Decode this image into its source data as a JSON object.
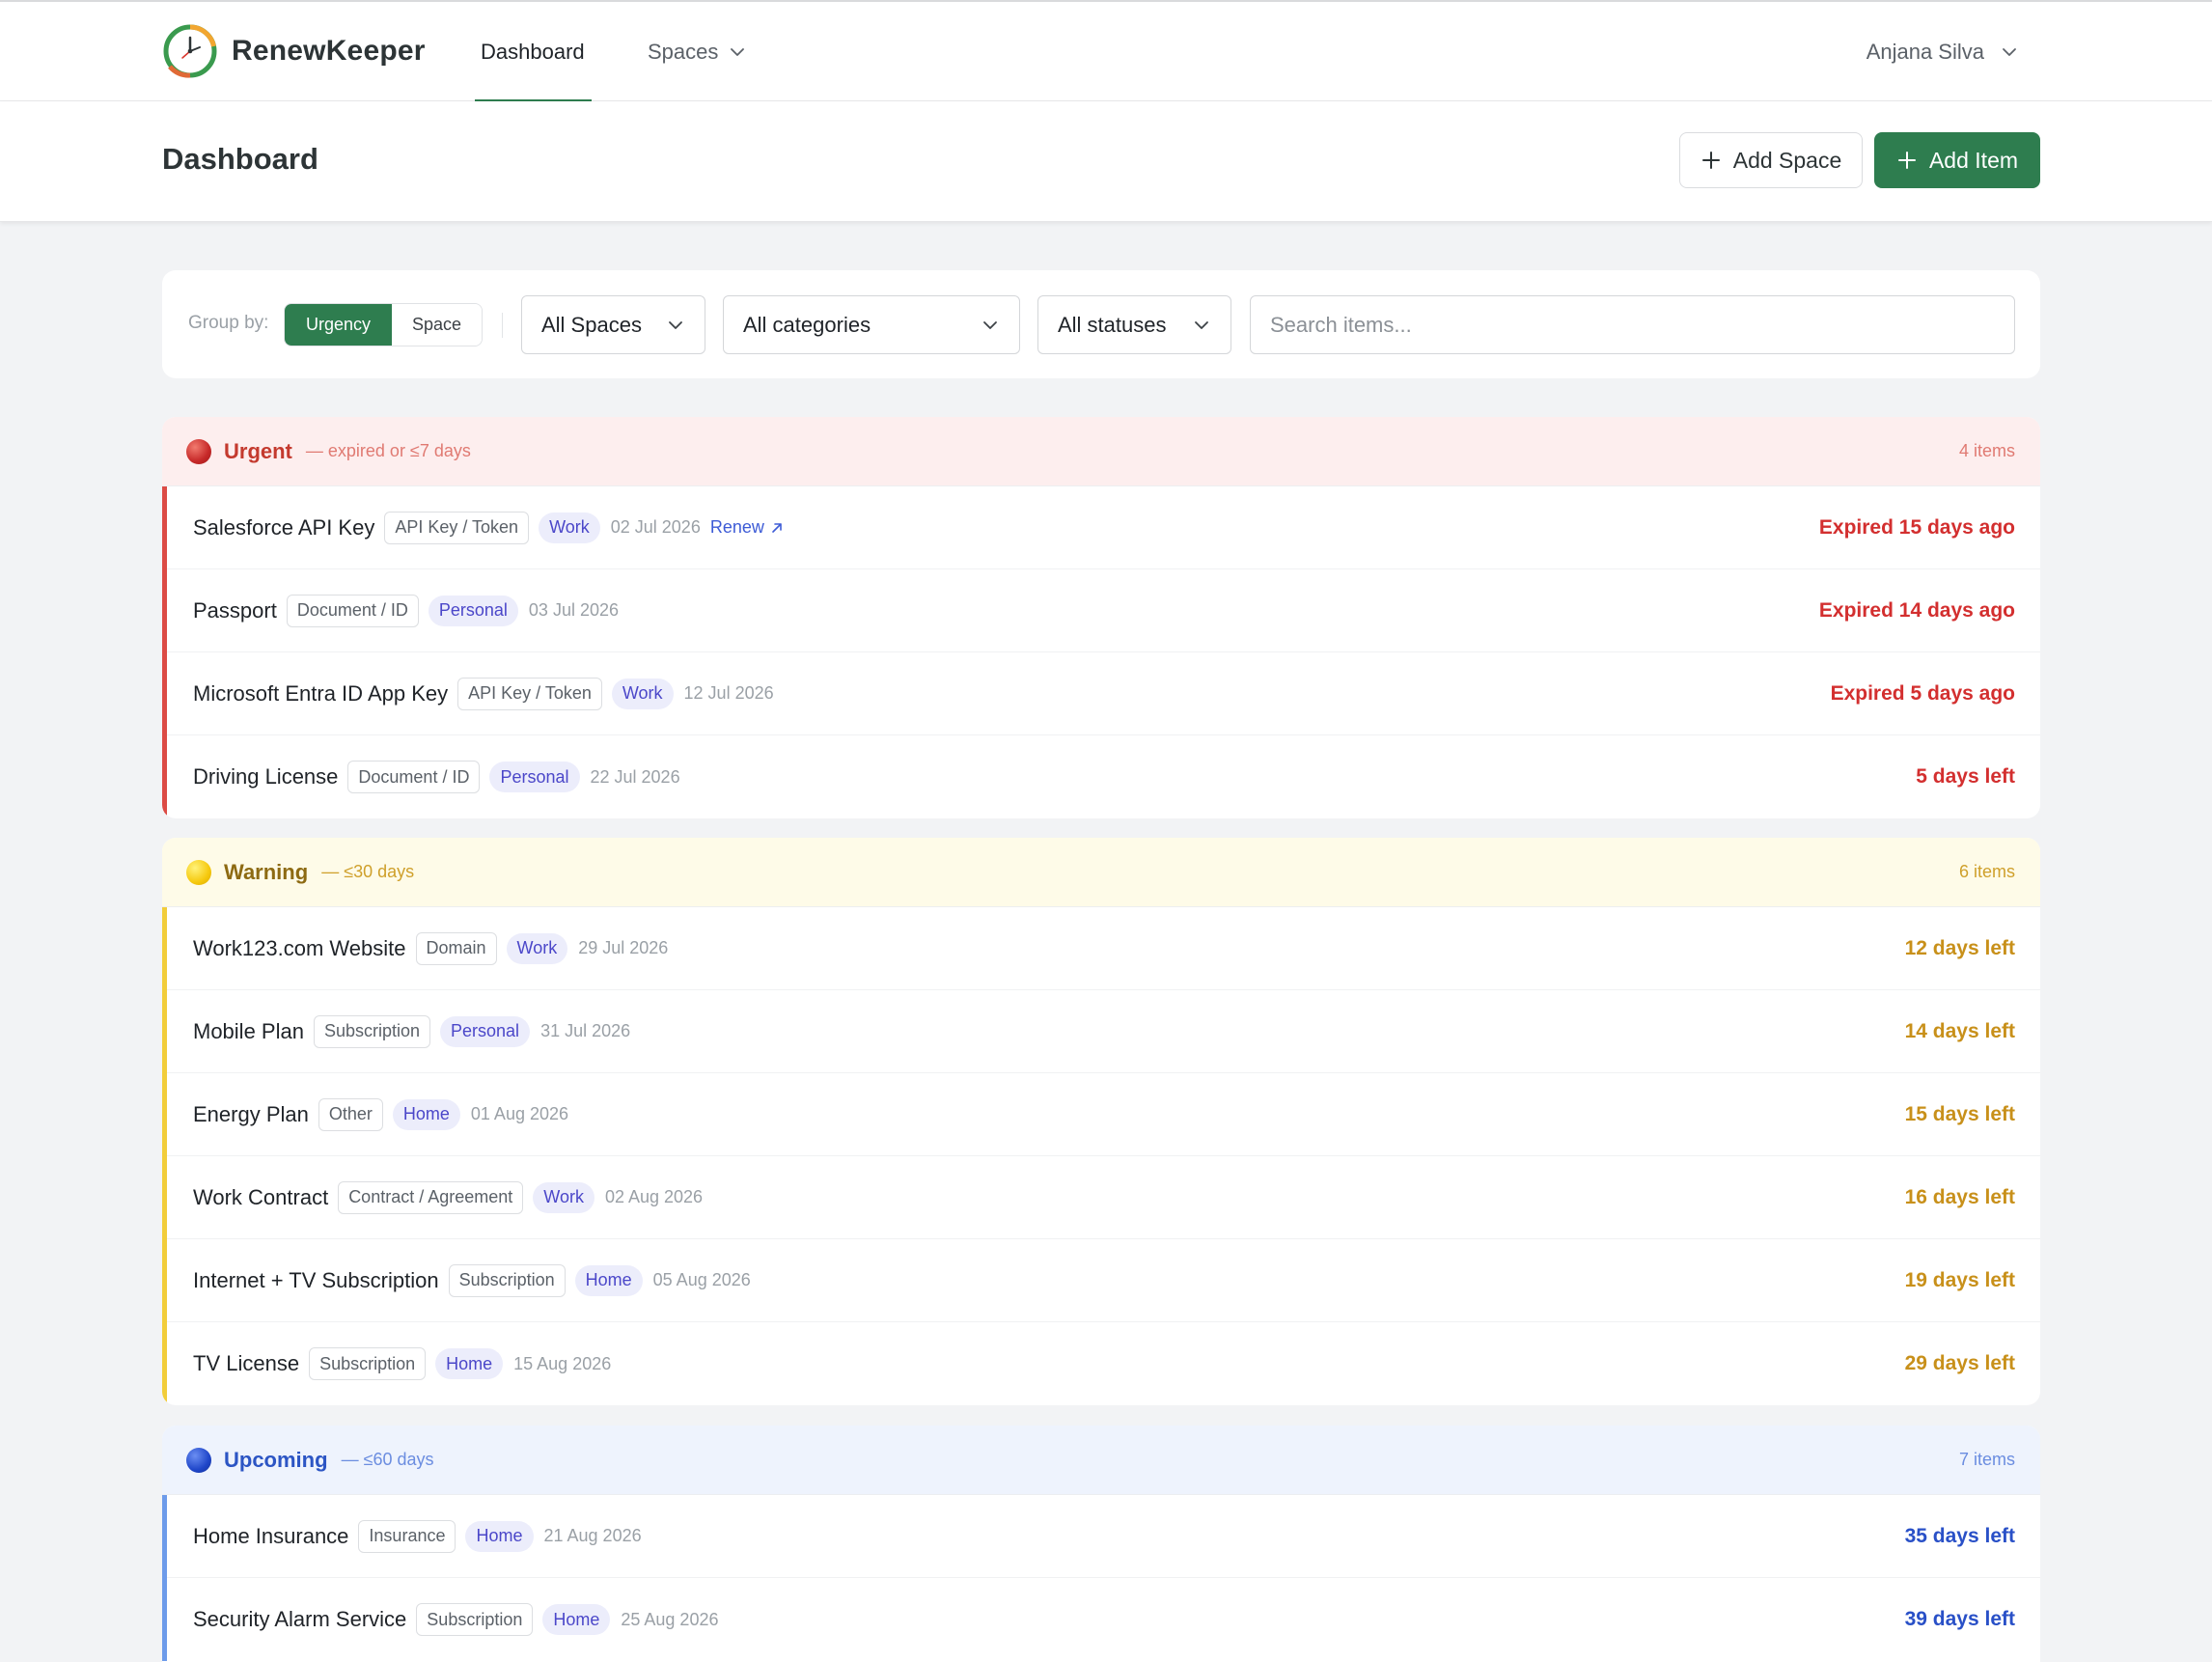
{
  "app": {
    "name": "RenewKeeper"
  },
  "nav": {
    "dashboard": "Dashboard",
    "spaces": "Spaces",
    "user": "Anjana Silva"
  },
  "page": {
    "title": "Dashboard",
    "add_space": "Add Space",
    "add_item": "Add Item"
  },
  "filters": {
    "group_by_label": "Group by:",
    "group_urgency": "Urgency",
    "group_space": "Space",
    "spaces": "All Spaces",
    "categories": "All categories",
    "statuses": "All statuses",
    "search_placeholder": "Search items..."
  },
  "groups": [
    {
      "title": "Urgent",
      "subtitle": "— expired or ≤7 days",
      "count": "4 items",
      "items": [
        {
          "name": "Salesforce API Key",
          "category": "API Key / Token",
          "space": "Work",
          "date": "02 Jul 2026",
          "action": "Renew",
          "status": "Expired 15 days ago"
        },
        {
          "name": "Passport",
          "category": "Document / ID",
          "space": "Personal",
          "date": "03 Jul 2026",
          "status": "Expired 14 days ago"
        },
        {
          "name": "Microsoft Entra ID App Key",
          "category": "API Key / Token",
          "space": "Work",
          "date": "12 Jul 2026",
          "status": "Expired 5 days ago"
        },
        {
          "name": "Driving License",
          "category": "Document / ID",
          "space": "Personal",
          "date": "22 Jul 2026",
          "status": "5 days left"
        }
      ]
    },
    {
      "title": "Warning",
      "subtitle": "— ≤30 days",
      "count": "6 items",
      "items": [
        {
          "name": "Work123.com Website",
          "category": "Domain",
          "space": "Work",
          "date": "29 Jul 2026",
          "status": "12 days left"
        },
        {
          "name": "Mobile Plan",
          "category": "Subscription",
          "space": "Personal",
          "date": "31 Jul 2026",
          "status": "14 days left"
        },
        {
          "name": "Energy Plan",
          "category": "Other",
          "space": "Home",
          "date": "01 Aug 2026",
          "status": "15 days left"
        },
        {
          "name": "Work Contract",
          "category": "Contract / Agreement",
          "space": "Work",
          "date": "02 Aug 2026",
          "status": "16 days left"
        },
        {
          "name": "Internet + TV Subscription",
          "category": "Subscription",
          "space": "Home",
          "date": "05 Aug 2026",
          "status": "19 days left"
        },
        {
          "name": "TV License",
          "category": "Subscription",
          "space": "Home",
          "date": "15 Aug 2026",
          "status": "29 days left"
        }
      ]
    },
    {
      "title": "Upcoming",
      "subtitle": "— ≤60 days",
      "count": "7 items",
      "items": [
        {
          "name": "Home Insurance",
          "category": "Insurance",
          "space": "Home",
          "date": "21 Aug 2026",
          "status": "35 days left"
        },
        {
          "name": "Security Alarm Service",
          "category": "Subscription",
          "space": "Home",
          "date": "25 Aug 2026",
          "status": "39 days left"
        }
      ]
    }
  ]
}
